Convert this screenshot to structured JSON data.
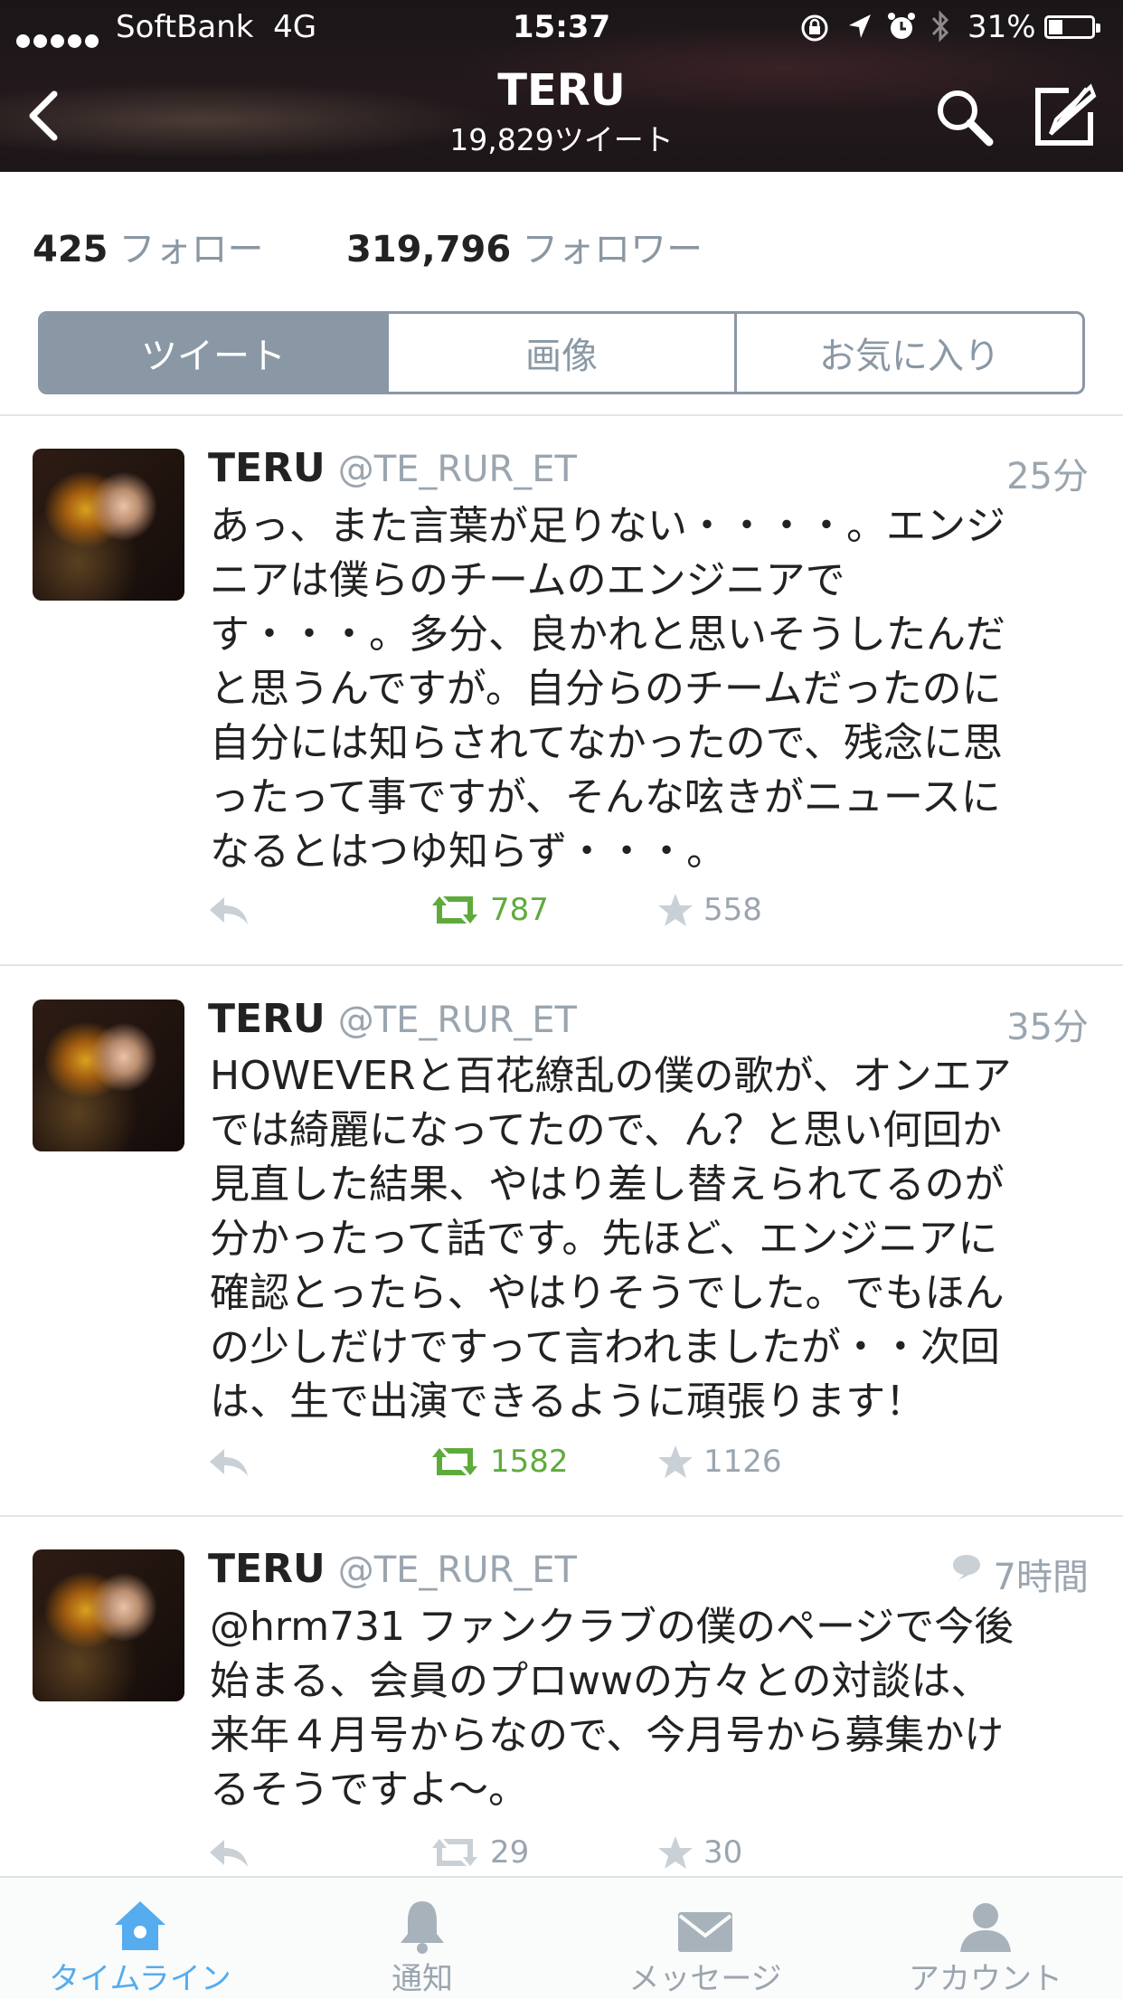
{
  "status_bar": {
    "carrier": "SoftBank",
    "network": "4G",
    "time": "15:37",
    "battery": "31%"
  },
  "header": {
    "title": "TERU",
    "subtitle": "19,829ツイート"
  },
  "profile": {
    "following_count": "425",
    "following_label": "フォロー",
    "followers_count": "319,796",
    "followers_label": "フォロワー"
  },
  "segments": [
    "ツイート",
    "画像",
    "お気に入り"
  ],
  "tweets": [
    {
      "name": "TERU",
      "handle": "@TE_RUR_ET",
      "time": "25分",
      "lines": [
        "あっ、また言葉が足りない・・・・。エンジ",
        "ニアは僕らのチームのエンジニアで",
        "す・・・。多分、良かれと思いそうしたんだ",
        "と思うんですが。自分らのチームだったのに",
        "自分には知らされてなかったので、残念に思",
        "ったって事ですが、そんな呟きがニュースに",
        "なるとはつゆ知らず・・・。"
      ],
      "retweets": "787",
      "favorites": "558"
    },
    {
      "name": "TERU",
      "handle": "@TE_RUR_ET",
      "time": "35分",
      "lines": [
        "HOWEVERと百花繚乱の僕の歌が、オンエア",
        "では綺麗になってたので、ん？と思い何回か",
        "見直した結果、やはり差し替えられてるのが",
        "分かったって話です。先ほど、エンジニアに",
        "確認とったら、やはりそうでした。でもほん",
        "の少しだけですって言われましたが・・次回",
        "は、生で出演できるように頑張ります！"
      ],
      "retweets": "1582",
      "favorites": "1126"
    },
    {
      "name": "TERU",
      "handle": "@TE_RUR_ET",
      "time": "7時間",
      "lines": [
        "@hrm731 ファンクラブの僕のページで今後",
        "始まる、会員のプロwwの方々との対談は、",
        "来年４月号からなので、今月号から募集かけ",
        "るそうですよ〜。"
      ],
      "retweets": "29",
      "favorites": "30"
    }
  ],
  "tabbar": {
    "timeline": "タイムライン",
    "notifications": "通知",
    "messages": "メッセージ",
    "account": "アカウント"
  },
  "colors": {
    "accent": "#55acee",
    "retweet": "#5eab3c",
    "muted": "#9aa5af"
  }
}
